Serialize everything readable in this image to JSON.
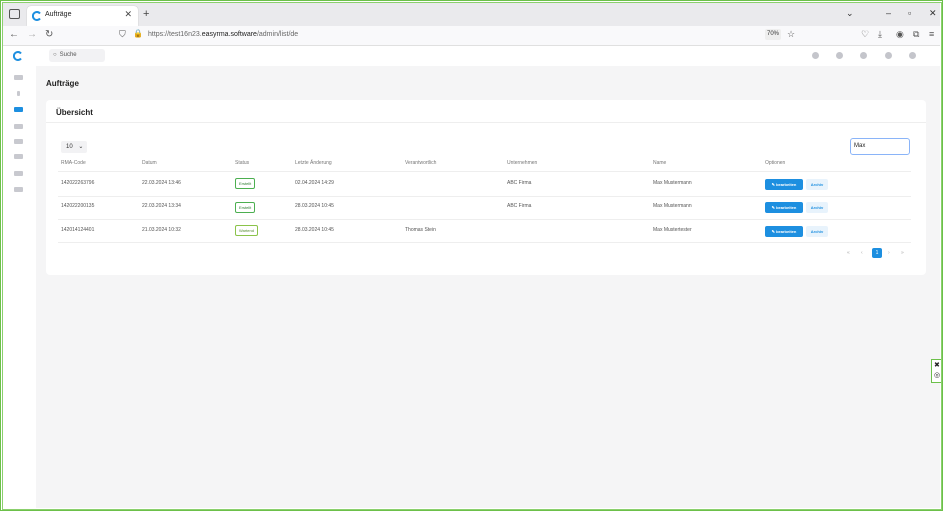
{
  "browser": {
    "tab_title": "Aufträge",
    "url_prefix": "https://test16n23.",
    "url_domain": "easyrma.software",
    "url_path": "/admin/list/de",
    "zoom": "70%"
  },
  "topbar": {
    "search_placeholder": "Suche"
  },
  "page": {
    "title": "Aufträge",
    "card_title": "Übersicht"
  },
  "table": {
    "per_page": "10",
    "filter_value": "Max",
    "headers": [
      "RMA-Code",
      "Datum",
      "Status",
      "Letzte Änderung",
      "Verantwortlich",
      "Unternehmen",
      "Name",
      "Optionen"
    ],
    "rows": [
      {
        "code": "142022263796",
        "datum": "22.03.2024 13:46",
        "status": "Erstellt",
        "aenderung": "02.04.2024 14:29",
        "verantwortlich": "",
        "unternehmen": "ABC Firma",
        "name": "Max Mustermann"
      },
      {
        "code": "142022200135",
        "datum": "22.03.2024 13:34",
        "status": "Erstellt",
        "aenderung": "28.03.2024 10:45",
        "verantwortlich": "",
        "unternehmen": "ABC Firma",
        "name": "Max Mustermann"
      },
      {
        "code": "142014124401",
        "datum": "21.03.2024 10:32",
        "status": "Wartend",
        "aenderung": "28.03.2024 10:45",
        "verantwortlich": "Thomas Stein",
        "unternehmen": "",
        "name": "Max Mustertester"
      }
    ],
    "edit_label": "✎ bearbeiten",
    "archive_label": "Archiv"
  },
  "pagination": {
    "first": "«",
    "prev": "‹",
    "current": "1",
    "next": "›",
    "last": "»"
  },
  "colors": {
    "accent": "#1d8fe0",
    "frame": "#6cc04a",
    "status_green": "#4caf50"
  }
}
